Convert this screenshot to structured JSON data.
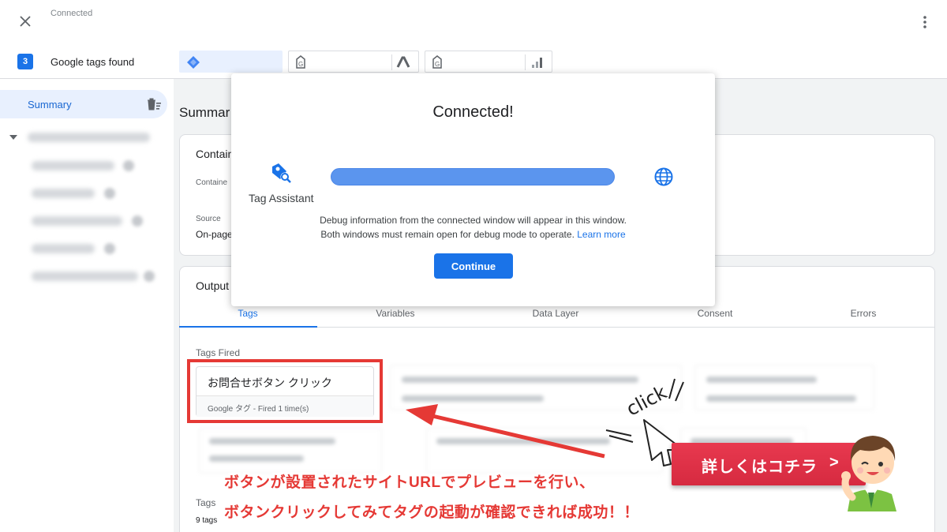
{
  "topbar": {
    "status": "Connected"
  },
  "tags_row": {
    "count": "3",
    "label": "Google tags found"
  },
  "sidebar": {
    "summary_label": "Summary"
  },
  "main": {
    "title": "Summar",
    "container_card": {
      "title": "Contain",
      "container_label": "Containe",
      "source_label": "Source",
      "source_value": "On-page"
    },
    "output_card": {
      "title": "Output",
      "tabs": [
        "Tags",
        "Variables",
        "Data Layer",
        "Consent",
        "Errors"
      ],
      "tags_fired_label": "Tags Fired",
      "fired_tag": {
        "name": "お問合せボタン クリック",
        "detail": "Google タグ - Fired 1 time(s)"
      },
      "tags_not_fired_label": "Tags",
      "tags_count": "9 tags"
    }
  },
  "modal": {
    "title": "Connected!",
    "assistant_label": "Tag Assistant",
    "desc_line1": "Debug information from the connected window will appear in this window.",
    "desc_line2": "Both windows must remain open for debug mode to operate.",
    "learn_more": "Learn more",
    "continue_label": "Continue"
  },
  "overlay": {
    "line1": "ボタンが設置されたサイトURLでプレビューを行い、",
    "line2": "ボタンクリックしてみてタグの起動が確認できれば成功！！",
    "cta_label": "詳しくはコチラ",
    "cta_arrow": ">",
    "click_label": "click"
  },
  "colors": {
    "accent": "#1a73e8",
    "annotation_red": "#e53935",
    "cta_red": "#e0344a"
  }
}
